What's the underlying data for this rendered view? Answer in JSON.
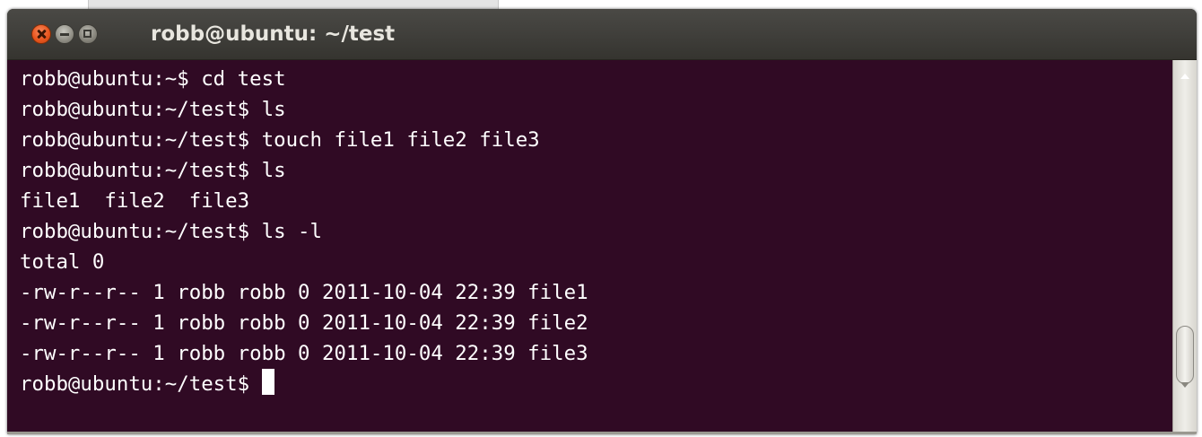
{
  "window": {
    "title": "robb@ubuntu: ~/test",
    "buttons": [
      "close-button",
      "minimize-button",
      "maximize-button"
    ]
  },
  "terminal": {
    "background": "#300a24",
    "foreground": "#ffffff",
    "lines": [
      "robb@ubuntu:~$ cd test",
      "robb@ubuntu:~/test$ ls",
      "robb@ubuntu:~/test$ touch file1 file2 file3",
      "robb@ubuntu:~/test$ ls",
      "file1  file2  file3",
      "robb@ubuntu:~/test$ ls -l",
      "total 0",
      "-rw-r--r-- 1 robb robb 0 2011-10-04 22:39 file1",
      "-rw-r--r-- 1 robb robb 0 2011-10-04 22:39 file2",
      "-rw-r--r-- 1 robb robb 0 2011-10-04 22:39 file3"
    ],
    "prompt": "robb@ubuntu:~/test$ "
  },
  "colors": {
    "close_button": "#e8561f",
    "titlebar": "#3f3e3a",
    "title_text": "#e8e6df"
  }
}
